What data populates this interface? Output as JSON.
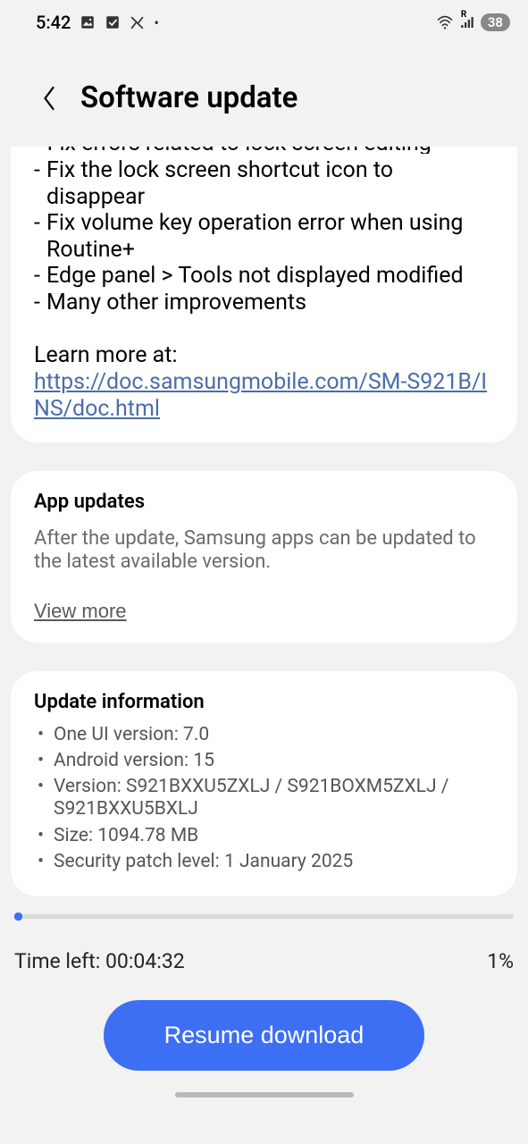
{
  "status": {
    "time": "5:42",
    "battery": "38",
    "signal_label": "R"
  },
  "header": {
    "title": "Software update"
  },
  "changelog": {
    "cutoff_line": "• Fix errors related to lock screen editing",
    "items": [
      "Fix the lock screen shortcut icon to disappear",
      "Fix volume key operation error when using Routine+",
      "Edge panel > Tools not displayed modified",
      "Many other improvements"
    ],
    "learn_more_label": "Learn more at:",
    "learn_more_url": "https://doc.samsungmobile.com/SM-S921B/INS/doc.html"
  },
  "app_updates": {
    "title": "App updates",
    "body": "After the update, Samsung apps can be updated to the latest available version.",
    "view_more": "View more"
  },
  "update_info": {
    "title": "Update information",
    "one_ui": "One UI version: 7.0",
    "android": "Android version: 15",
    "version": "Version: S921BXXU5ZXLJ / S921BOXM5ZXLJ / S921BXXU5BXLJ",
    "size": "Size: 1094.78 MB",
    "patch": "Security patch level: 1 January 2025"
  },
  "progress": {
    "percent": 1,
    "percent_label": "1%",
    "time_left": "Time left: 00:04:32",
    "resume_label": "Resume download"
  }
}
